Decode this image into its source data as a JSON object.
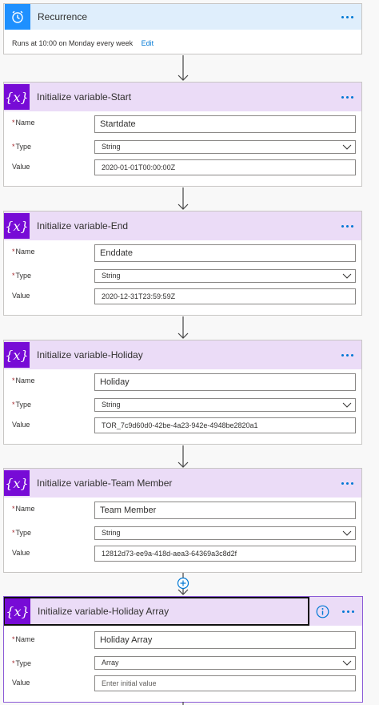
{
  "recurrence": {
    "title": "Recurrence",
    "summary": "Runs at 10:00 on Monday every week",
    "edit_label": "Edit",
    "icon": "alarm-clock-icon",
    "accent": "#1e90ff",
    "header_bg": "#dfeefc"
  },
  "actions": [
    {
      "title": "Initialize variable-Start",
      "name_label": "Name",
      "name_value": "Startdate",
      "type_label": "Type",
      "type_value": "String",
      "value_label": "Value",
      "value_value": "2020-01-01T00:00:00Z"
    },
    {
      "title": "Initialize variable-End",
      "name_label": "Name",
      "name_value": "Enddate",
      "type_label": "Type",
      "type_value": "String",
      "value_label": "Value",
      "value_value": "2020-12-31T23:59:59Z"
    },
    {
      "title": "Initialize variable-Holiday",
      "name_label": "Name",
      "name_value": "Holiday",
      "type_label": "Type",
      "type_value": "String",
      "value_label": "Value",
      "value_value": "TOR_7c9d60d0-42be-4a23-942e-4948be2820a1"
    },
    {
      "title": "Initialize variable-Team Member",
      "name_label": "Name",
      "name_value": "Team Member",
      "type_label": "Type",
      "type_value": "String",
      "value_label": "Value",
      "value_value": "12812d73-ee9a-418d-aea3-64369a3c8d2f"
    },
    {
      "title": "Initialize variable-Holiday Array",
      "name_label": "Name",
      "name_value": "Holiday Array",
      "type_label": "Type",
      "type_value": "Array",
      "value_label": "Value",
      "value_placeholder": "Enter initial value"
    }
  ],
  "variable_icon_symbol": "{x}",
  "variable_icon": "variable-icon",
  "colors": {
    "variable_accent": "#770bd6",
    "variable_header_bg": "#ebdcf7",
    "link": "#0078d4",
    "required": "#a4262c"
  }
}
